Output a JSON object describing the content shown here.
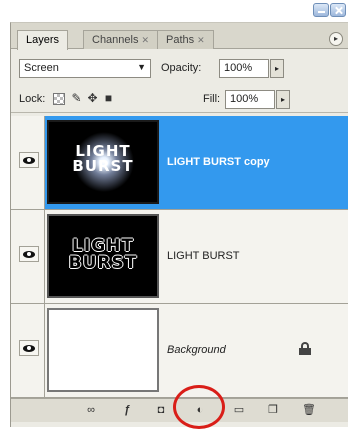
{
  "tabs": [
    {
      "label": "Layers",
      "closable": false
    },
    {
      "label": "Channels",
      "closable": true
    },
    {
      "label": "Paths",
      "closable": true
    }
  ],
  "blend_mode": "Screen",
  "opacity_label": "Opacity:",
  "opacity_value": "100%",
  "lock_label": "Lock:",
  "lock_icons": [
    "lock-transparent-pixels-icon",
    "lock-image-pixels-icon",
    "lock-position-icon",
    "lock-all-icon"
  ],
  "fill_label": "Fill:",
  "fill_value": "100%",
  "layers": [
    {
      "name": "LIGHT BURST copy",
      "thumb_text": "LIGHT\nBURST",
      "selected": true,
      "visible": true,
      "locked": false
    },
    {
      "name": "LIGHT BURST",
      "thumb_text": "LIGHT\nBURST",
      "selected": false,
      "visible": true,
      "locked": false
    },
    {
      "name": "Background",
      "thumb_text": "",
      "selected": false,
      "visible": true,
      "locked": true
    }
  ],
  "bottom_icons": [
    "link-layers-icon",
    "layer-style-icon",
    "add-mask-icon",
    "adjustment-layer-icon",
    "new-group-icon",
    "new-layer-icon",
    "delete-layer-icon"
  ],
  "colors": {
    "selection": "#3399ee",
    "highlight_circle": "#d91e18",
    "panel": "#ecebe4"
  }
}
